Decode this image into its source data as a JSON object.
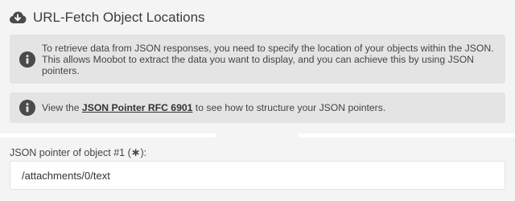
{
  "header": {
    "title": "URL-Fetch Object Locations",
    "icon": "cloud-download-icon"
  },
  "info_boxes": [
    {
      "icon": "info-icon",
      "text": "To retrieve data from JSON responses, you need to specify the location of your objects within the JSON. This allows Moobot to extract the data you want to display, and you can achieve this by using JSON pointers."
    },
    {
      "icon": "info-icon",
      "text_before": "View the ",
      "link_text": "JSON Pointer RFC 6901",
      "text_after": " to see how to structure your JSON pointers."
    }
  ],
  "field": {
    "label_prefix": "JSON pointer of object #1 (",
    "label_required": "∗",
    "label_suffix": "):",
    "value": "/attachments/0/text"
  },
  "colors": {
    "panel_background": "#f4f4f4",
    "info_background": "#e4e4e4",
    "icon_color": "#4a4a4a",
    "text_color": "#444444"
  }
}
